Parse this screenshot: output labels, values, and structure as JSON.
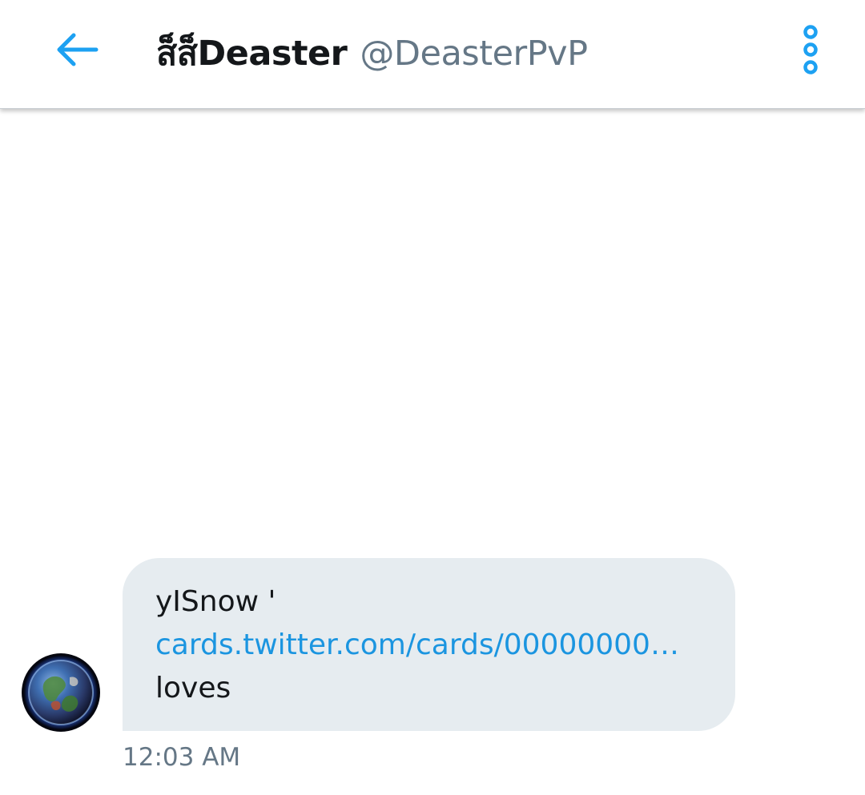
{
  "header": {
    "display_name": "ส็ส็Deaster",
    "handle": "@DeasterPvP",
    "back_icon": "arrow-left-icon",
    "more_icon": "vertical-more-icon"
  },
  "conversation": {
    "message": {
      "line1": "yISnow '",
      "link": "cards.twitter.com/cards/00000000…",
      "line3": "loves",
      "timestamp": "12:03 AM"
    },
    "sender_avatar": "earth-avatar"
  },
  "colors": {
    "accent": "#1da1f2",
    "link": "#1b95e0",
    "bubble": "#e6ecf0",
    "muted_text": "#657786",
    "primary_text": "#14171a"
  }
}
